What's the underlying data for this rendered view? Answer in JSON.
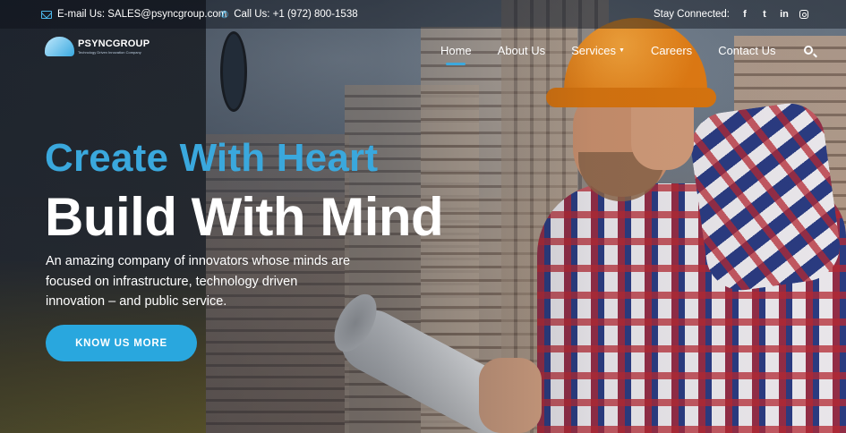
{
  "topbar": {
    "email_label": "E-mail Us: SALES@psyncgroup.com",
    "phone_label": "Call Us: +1 (972) 800-1538",
    "stay_connected": "Stay Connected:",
    "social": [
      {
        "icon": "facebook-icon",
        "glyph": "f"
      },
      {
        "icon": "twitter-icon",
        "glyph": "t"
      },
      {
        "icon": "linkedin-icon",
        "glyph": "in"
      },
      {
        "icon": "instagram-icon",
        "glyph": ""
      }
    ]
  },
  "brand": {
    "name": "PSYNCGROUP",
    "tagline": "Technology Driven Innovation Company"
  },
  "nav": {
    "items": [
      {
        "label": "Home",
        "active": true
      },
      {
        "label": "About Us"
      },
      {
        "label": "Services"
      },
      {
        "label": "Careers"
      },
      {
        "label": "Contact Us"
      }
    ],
    "search_icon": "search-icon"
  },
  "hero": {
    "accent_heading": "Create With Heart",
    "main_heading": "Build With Mind",
    "description": "An amazing company of innovators whose minds are focused on infrastructure, technology driven innovation – and public service.",
    "cta_label": "KNOW US MORE"
  },
  "colors": {
    "accent": "#3aa8dd",
    "button": "#29a7de"
  }
}
